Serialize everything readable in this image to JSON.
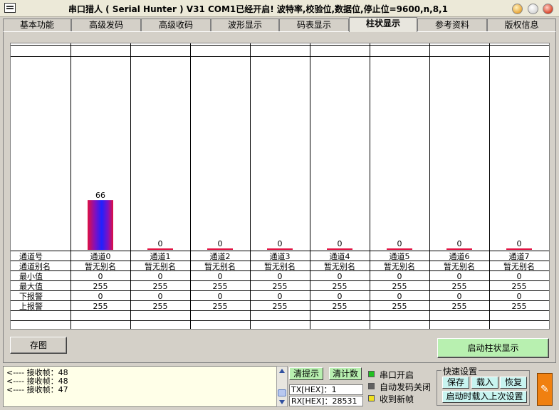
{
  "window": {
    "title": "串口猎人 ( Serial Hunter ) V31    COM1已经开启!  波特率,校验位,数据位,停止位=9600,n,8,1"
  },
  "tabs": [
    {
      "label": "基本功能"
    },
    {
      "label": "高级发码"
    },
    {
      "label": "高级收码"
    },
    {
      "label": "波形显示"
    },
    {
      "label": "码表显示"
    },
    {
      "label": "柱状显示",
      "active": true
    },
    {
      "label": "参考资料"
    },
    {
      "label": "版权信息"
    }
  ],
  "chart_data": {
    "type": "bar",
    "categories": [
      "通道0",
      "通道1",
      "通道2",
      "通道3",
      "通道4",
      "通道5",
      "通道6",
      "通道7"
    ],
    "values": [
      66,
      0,
      0,
      0,
      0,
      0,
      0,
      0
    ],
    "ylim": [
      0,
      255
    ]
  },
  "table": {
    "row_labels": [
      "通道号",
      "通道别名",
      "最小值",
      "最大值",
      "下报警",
      "上报警"
    ],
    "aliases": [
      "暂无别名",
      "暂无别名",
      "暂无别名",
      "暂无别名",
      "暂无别名",
      "暂无别名",
      "暂无别名",
      "暂无别名"
    ],
    "min": [
      "0",
      "0",
      "0",
      "0",
      "0",
      "0",
      "0",
      "0"
    ],
    "max": [
      "255",
      "255",
      "255",
      "255",
      "255",
      "255",
      "255",
      "255"
    ],
    "low_alarm": [
      "0",
      "0",
      "0",
      "0",
      "0",
      "0",
      "0",
      "0"
    ],
    "high_alarm": [
      "255",
      "255",
      "255",
      "255",
      "255",
      "255",
      "255",
      "255"
    ]
  },
  "buttons": {
    "save_image": "存图",
    "start_bar": "启动柱状显示",
    "clear_hint": "清提示",
    "clear_count": "清计数"
  },
  "log": {
    "lines": [
      "<---- 接收帧：48",
      "<---- 接收帧：48",
      "<---- 接收帧：47"
    ]
  },
  "counters": {
    "tx": "TX[HEX]：1",
    "rx": "RX[HEX]：28531"
  },
  "status": {
    "port_open": "串口开启",
    "auto_send_off": "自动发码关闭",
    "new_frame": "收到新帧",
    "colors": {
      "port_open": "#20c020",
      "auto_send_off": "#606060",
      "new_frame": "#f0e020"
    }
  },
  "quick": {
    "legend": "快速设置",
    "save": "保存",
    "load": "载入",
    "restore": "恢复",
    "load_last": "启动时载入上次设置"
  }
}
